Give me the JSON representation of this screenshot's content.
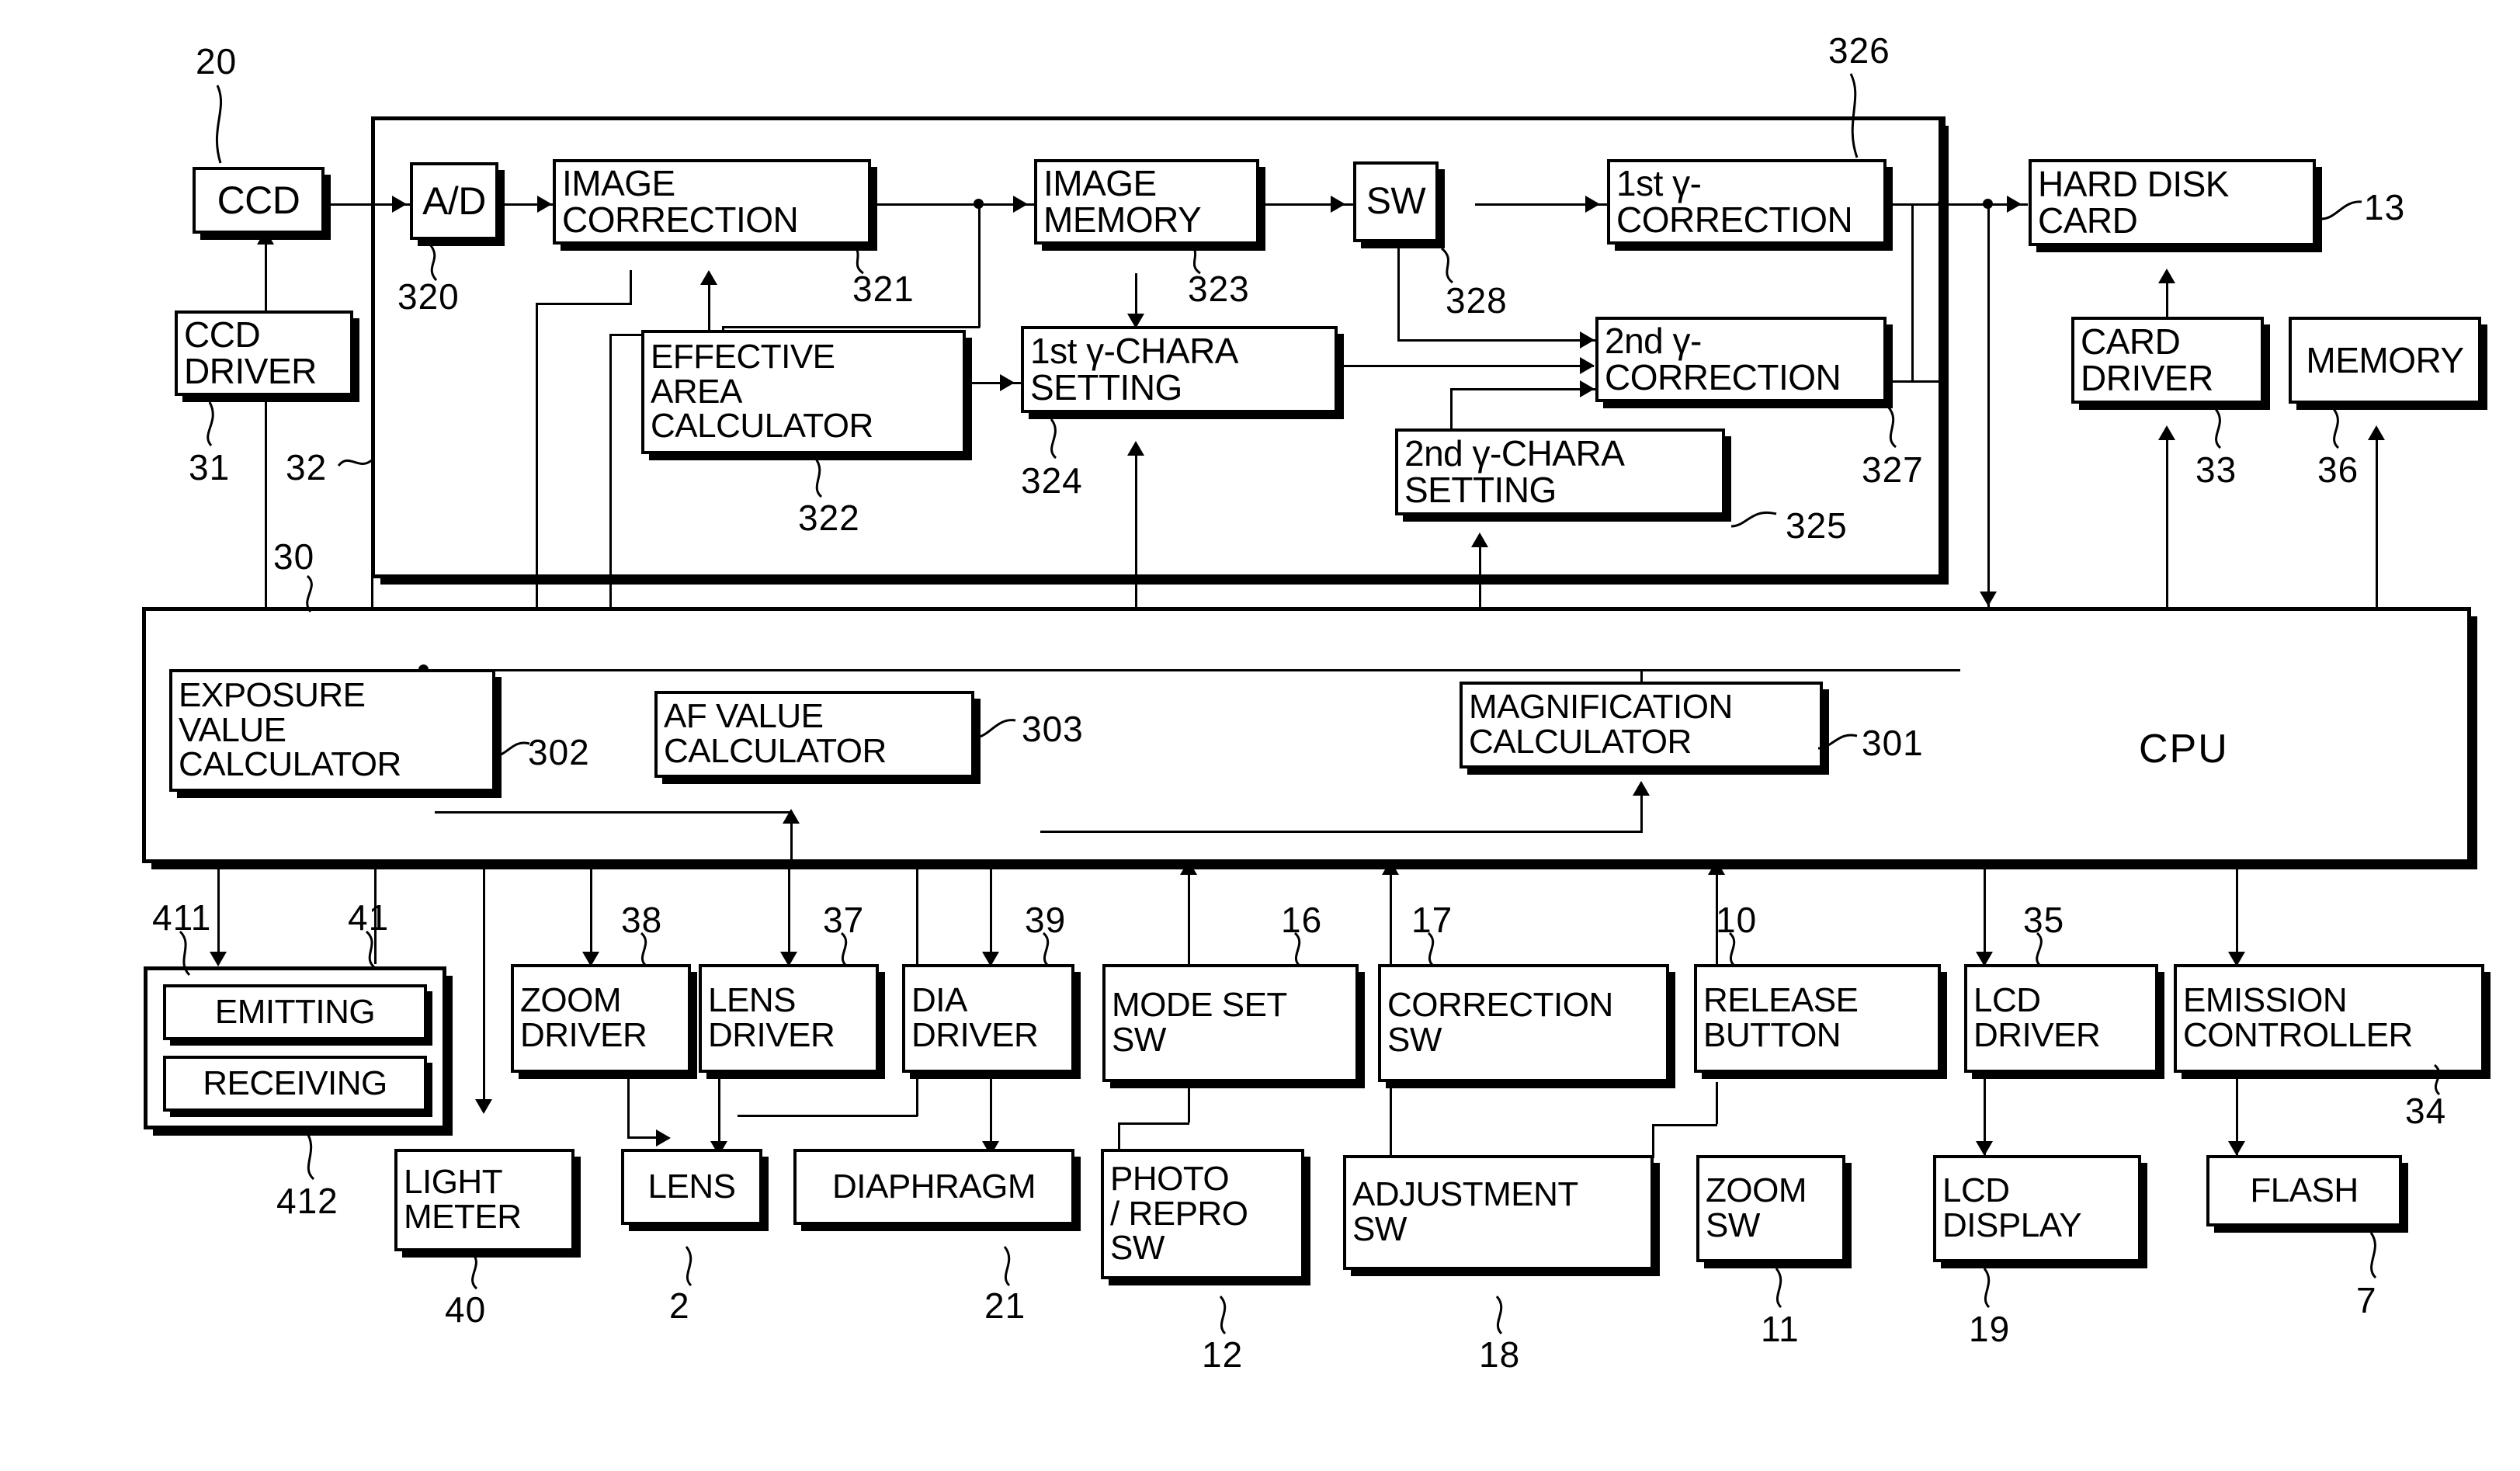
{
  "figure": {
    "kind": "patent-block-diagram",
    "title": "Electronic camera control block diagram"
  },
  "blocks": {
    "ccd": {
      "lines": [
        "CCD"
      ]
    },
    "ad": {
      "lines": [
        "A/D"
      ]
    },
    "image_correction": {
      "lines": [
        "IMAGE",
        "CORRECTION"
      ]
    },
    "image_memory": {
      "lines": [
        "IMAGE",
        "MEMORY"
      ]
    },
    "sw": {
      "lines": [
        "SW"
      ]
    },
    "gamma1_corr": {
      "lines": [
        "1st γ-",
        "CORRECTION"
      ]
    },
    "hard_disk_card": {
      "lines": [
        "HARD DISK",
        "CARD"
      ]
    },
    "ccd_driver": {
      "lines": [
        "CCD",
        "DRIVER"
      ]
    },
    "effective_area": {
      "lines": [
        "EFFECTIVE",
        "AREA",
        "CALCULATOR"
      ]
    },
    "gamma1_chara": {
      "lines": [
        "1st γ-CHARA",
        "SETTING"
      ]
    },
    "gamma2_corr": {
      "lines": [
        "2nd γ-",
        "CORRECTION"
      ]
    },
    "gamma2_chara": {
      "lines": [
        "2nd γ-CHARA",
        "SETTING"
      ]
    },
    "card_driver": {
      "lines": [
        "CARD",
        "DRIVER"
      ]
    },
    "memory": {
      "lines": [
        "MEMORY"
      ]
    },
    "exposure_calc": {
      "lines": [
        "EXPOSURE",
        "VALUE",
        "CALCULATOR"
      ]
    },
    "af_calc": {
      "lines": [
        "AF VALUE",
        "CALCULATOR"
      ]
    },
    "magnif_calc": {
      "lines": [
        "MAGNIFICATION",
        "CALCULATOR"
      ]
    },
    "cpu": {
      "label": "CPU"
    },
    "strobe_unit": {
      "emitting": "EMITTING",
      "receiving": "RECEIVING"
    },
    "zoom_driver": {
      "lines": [
        "ZOOM",
        "DRIVER"
      ]
    },
    "lens_driver": {
      "lines": [
        "LENS",
        "DRIVER"
      ]
    },
    "dia_driver": {
      "lines": [
        "DIA",
        "DRIVER"
      ]
    },
    "mode_set_sw": {
      "lines": [
        "MODE SET",
        "SW"
      ]
    },
    "correction_sw": {
      "lines": [
        "CORRECTION",
        "SW"
      ]
    },
    "release_button": {
      "lines": [
        "RELEASE",
        "BUTTON"
      ]
    },
    "lcd_driver": {
      "lines": [
        "LCD",
        "DRIVER"
      ]
    },
    "emission_ctrl": {
      "lines": [
        "EMISSION",
        "CONTROLLER"
      ]
    },
    "light_meter": {
      "lines": [
        "LIGHT",
        "METER"
      ]
    },
    "lens": {
      "lines": [
        "LENS"
      ]
    },
    "diaphragm": {
      "lines": [
        "DIAPHRAGM"
      ]
    },
    "photo_repro_sw": {
      "lines": [
        "PHOTO",
        "/ REPRO",
        "SW"
      ]
    },
    "adjustment_sw": {
      "lines": [
        "ADJUSTMENT",
        "SW"
      ]
    },
    "zoom_sw": {
      "lines": [
        "ZOOM",
        "SW"
      ]
    },
    "lcd_display": {
      "lines": [
        "LCD",
        "DISPLAY"
      ]
    },
    "flash": {
      "lines": [
        "FLASH"
      ]
    }
  },
  "refs": {
    "r20": "20",
    "r320": "320",
    "r321": "321",
    "r323": "323",
    "r326": "326",
    "r13": "13",
    "r31": "31",
    "r32": "32",
    "r322": "322",
    "r324": "324",
    "r328": "328",
    "r327": "327",
    "r325": "325",
    "r33": "33",
    "r36": "36",
    "r30": "30",
    "r302": "302",
    "r303": "303",
    "r301": "301",
    "r411": "411",
    "r41": "41",
    "r412": "412",
    "r40": "40",
    "r38": "38",
    "r37": "37",
    "r39": "39",
    "r16": "16",
    "r17": "17",
    "r10": "10",
    "r35": "35",
    "r34": "34",
    "r2": "2",
    "r21": "21",
    "r12": "12",
    "r18": "18",
    "r11": "11",
    "r19": "19",
    "r7": "7"
  }
}
